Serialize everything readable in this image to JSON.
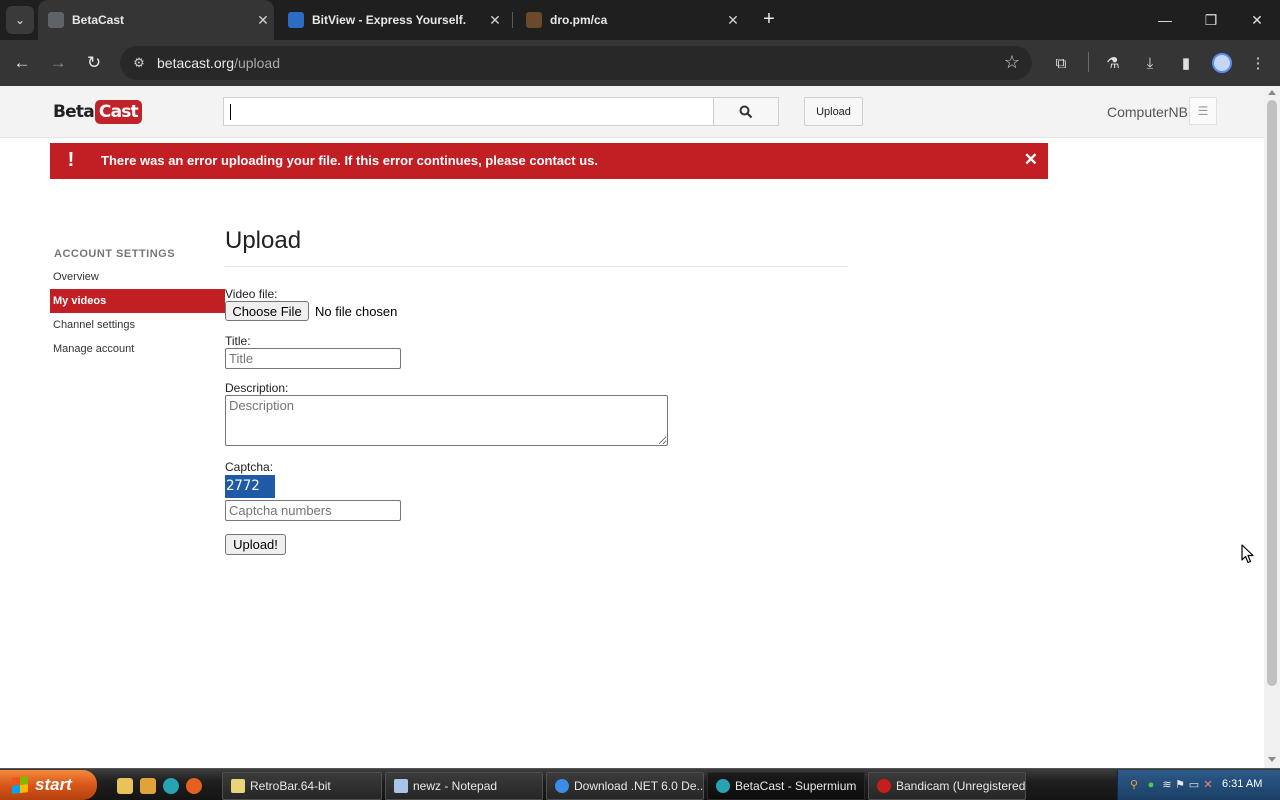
{
  "browser": {
    "tabs": [
      {
        "title": "BetaCast",
        "active": true
      },
      {
        "title": "BitView - Express Yourself.",
        "active": false
      },
      {
        "title": "dro.pm/ca",
        "active": false
      }
    ],
    "close_glyph": "✕",
    "new_tab_glyph": "+",
    "url_host": "betacast.org",
    "url_path": "/upload"
  },
  "site": {
    "logo_beta": "Beta",
    "logo_cast": "Cast",
    "search_value": "",
    "upload_label": "Upload",
    "username": "ComputerNB"
  },
  "alert": {
    "message": "There was an error uploading your file. If this error continues, please contact us.",
    "icon": "!",
    "close": "✕",
    "color": "#c21f25"
  },
  "sidebar": {
    "heading": "ACCOUNT SETTINGS",
    "items": [
      {
        "label": "Overview"
      },
      {
        "label": "My videos",
        "active": true
      },
      {
        "label": "Channel settings"
      },
      {
        "label": "Manage account"
      }
    ]
  },
  "form": {
    "title": "Upload",
    "video_label": "Video file:",
    "choose_file_label": "Choose File",
    "file_status": "No file chosen",
    "title_label": "Title:",
    "title_placeholder": "Title",
    "description_label": "Description:",
    "description_placeholder": "Description",
    "captcha_label": "Captcha:",
    "captcha_value": "2772",
    "captcha_placeholder": "Captcha numbers",
    "submit_label": "Upload!"
  },
  "taskbar": {
    "start_label": "start",
    "tasks": [
      {
        "label": "RetroBar.64-bit",
        "active": false
      },
      {
        "label": "newz - Notepad",
        "active": false
      },
      {
        "label": "Download .NET 6.0 De...",
        "active": false
      },
      {
        "label": "BetaCast - Supermium",
        "active": true
      },
      {
        "label": "Bandicam (Unregistered)",
        "active": false
      }
    ],
    "clock": "6:31 AM"
  },
  "colors": {
    "brand_red": "#c21f25",
    "captcha_bg": "#1f5aa6"
  }
}
